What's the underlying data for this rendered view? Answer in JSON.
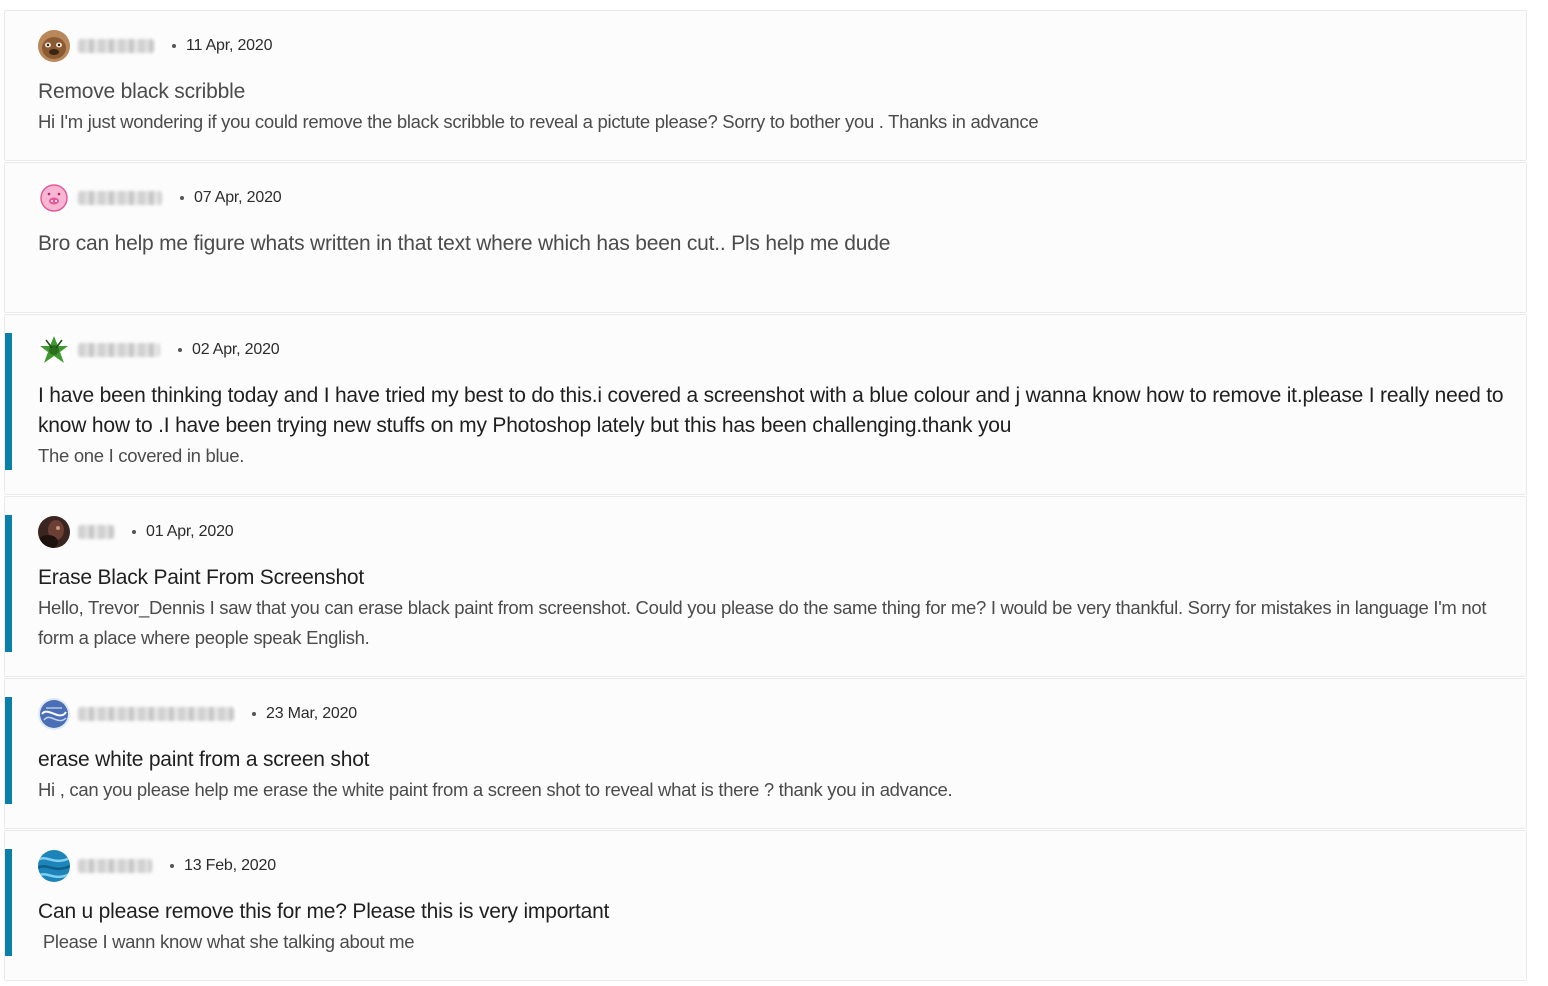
{
  "posts": [
    {
      "author": "",
      "date": "11 Apr, 2020",
      "title": "Remove black scribble",
      "body": "Hi I'm just wondering if you could remove the black scribble to reveal a pictute please? Sorry to bother you     . Thanks in advance",
      "highlighted": false,
      "avatar_icon": "bulldog-avatar-icon",
      "avatar_color": "#9c6a3e"
    },
    {
      "author": "",
      "date": "07 Apr, 2020",
      "title": "Bro can help me figure whats written in that text where which has been cut.. Pls help me dude",
      "body": "",
      "highlighted": false,
      "avatar_icon": "pink-pig-avatar-icon",
      "avatar_color": "#e8589a"
    },
    {
      "author": "",
      "date": "02 Apr, 2020",
      "title": "I have been thinking today and I have tried my best to do this.i covered a screenshot with a blue colour and j wanna know how to remove it.please I really need to know how to .I have been trying new stuffs on my Photoshop lately but this has been challenging.thank you",
      "body": "The one I covered in blue.",
      "highlighted": true,
      "avatar_icon": "green-leaf-avatar-icon",
      "avatar_color": "#3f9b2f"
    },
    {
      "author": "",
      "date": "01 Apr, 2020",
      "title": "Erase Black Paint From Screenshot",
      "body": "Hello, Trevor_Dennis I saw that you can erase black paint from screenshot. Could you please do the same thing for me? I would be very thankful. Sorry for mistakes in language I'm not form a place where people speak English.",
      "highlighted": true,
      "avatar_icon": "photo-avatar-icon",
      "avatar_color": "#3b2520"
    },
    {
      "author": "",
      "date": "23 Mar, 2020",
      "title": "erase white paint from a screen shot",
      "body": "Hi , can you please help me erase the white paint from a screen shot to reveal what is there ? thank you in advance.",
      "highlighted": true,
      "avatar_icon": "blue-pattern-avatar-icon",
      "avatar_color": "#4a6fb5"
    },
    {
      "author": "",
      "date": "13 Feb, 2020",
      "title": "Can u please remove this for me? Please this is very important",
      "body": " Please I wann know what she talking about me",
      "highlighted": true,
      "avatar_icon": "blue-wave-avatar-icon",
      "avatar_color": "#1c84b8"
    }
  ]
}
